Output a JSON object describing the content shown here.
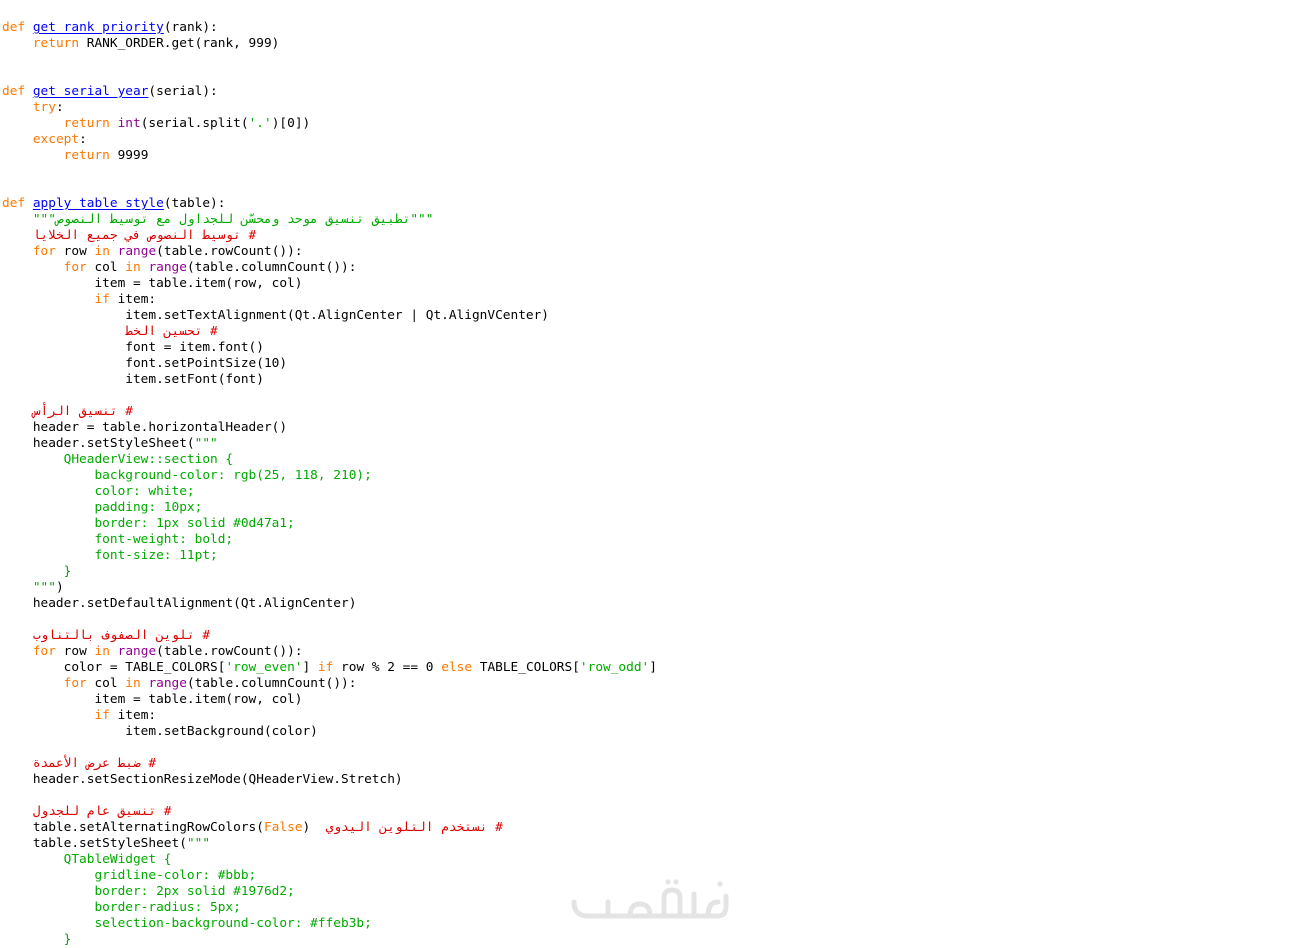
{
  "window": {
    "title": "",
    "background": "#ffffff"
  },
  "syntax_colors": {
    "keyword": "#ff7700",
    "function_name": "#0000ff",
    "builtin": "#900090",
    "string": "#00aa00",
    "comment": "#dd0000",
    "text": "#000000"
  },
  "watermark": {
    "logo": "khamsat-logo",
    "text": "خمسات",
    "color": "#d6d6d6"
  },
  "code": {
    "lines": [
      [
        [
          "kw",
          "def"
        ],
        [
          "t",
          " "
        ],
        [
          "fn",
          "get_rank_priority"
        ],
        [
          "t",
          "(rank):"
        ]
      ],
      [
        [
          "t",
          "    "
        ],
        [
          "kw",
          "return"
        ],
        [
          "t",
          " RANK_ORDER.get(rank, 999)"
        ]
      ],
      [],
      [],
      [
        [
          "kw",
          "def"
        ],
        [
          "t",
          " "
        ],
        [
          "fn",
          "get_serial_year"
        ],
        [
          "t",
          "(serial):"
        ]
      ],
      [
        [
          "t",
          "    "
        ],
        [
          "kw",
          "try"
        ],
        [
          "t",
          ":"
        ]
      ],
      [
        [
          "t",
          "        "
        ],
        [
          "kw",
          "return"
        ],
        [
          "t",
          " "
        ],
        [
          "bi",
          "int"
        ],
        [
          "t",
          "(serial.split("
        ],
        [
          "str",
          "'.'"
        ],
        [
          "t",
          ")[0])"
        ]
      ],
      [
        [
          "t",
          "    "
        ],
        [
          "kw",
          "except"
        ],
        [
          "t",
          ":"
        ]
      ],
      [
        [
          "t",
          "        "
        ],
        [
          "kw",
          "return"
        ],
        [
          "t",
          " 9999"
        ]
      ],
      [],
      [],
      [
        [
          "kw",
          "def"
        ],
        [
          "t",
          " "
        ],
        [
          "fn",
          "apply_table_style"
        ],
        [
          "t",
          "(table):"
        ]
      ],
      [
        [
          "t",
          "    "
        ],
        [
          "str",
          "\"\"\"تطبيق تنسيق موحد ومحسّن للجداول مع توسيط النصوص\"\"\""
        ]
      ],
      [
        [
          "t",
          "    "
        ],
        [
          "cm",
          "# توسيط النصوص في جميع الخلايا"
        ]
      ],
      [
        [
          "t",
          "    "
        ],
        [
          "kw",
          "for"
        ],
        [
          "t",
          " row "
        ],
        [
          "kw",
          "in"
        ],
        [
          "t",
          " "
        ],
        [
          "bi",
          "range"
        ],
        [
          "t",
          "(table.rowCount()):"
        ]
      ],
      [
        [
          "t",
          "        "
        ],
        [
          "kw",
          "for"
        ],
        [
          "t",
          " col "
        ],
        [
          "kw",
          "in"
        ],
        [
          "t",
          " "
        ],
        [
          "bi",
          "range"
        ],
        [
          "t",
          "(table.columnCount()):"
        ]
      ],
      [
        [
          "t",
          "            item = table.item(row, col)"
        ]
      ],
      [
        [
          "t",
          "            "
        ],
        [
          "kw",
          "if"
        ],
        [
          "t",
          " item:"
        ]
      ],
      [
        [
          "t",
          "                item.setTextAlignment(Qt.AlignCenter | Qt.AlignVCenter)"
        ]
      ],
      [
        [
          "t",
          "                "
        ],
        [
          "cm",
          "# تحسين الخط"
        ]
      ],
      [
        [
          "t",
          "                font = item.font()"
        ]
      ],
      [
        [
          "t",
          "                font.setPointSize(10)"
        ]
      ],
      [
        [
          "t",
          "                item.setFont(font)"
        ]
      ],
      [],
      [
        [
          "t",
          "    "
        ],
        [
          "cm",
          "# تنسيق الرأس"
        ]
      ],
      [
        [
          "t",
          "    header = table.horizontalHeader()"
        ]
      ],
      [
        [
          "t",
          "    header.setStyleSheet("
        ],
        [
          "str",
          "\"\"\""
        ]
      ],
      [
        [
          "str",
          "        QHeaderView::section {"
        ]
      ],
      [
        [
          "str",
          "            background-color: rgb(25, 118, 210);"
        ]
      ],
      [
        [
          "str",
          "            color: white;"
        ]
      ],
      [
        [
          "str",
          "            padding: 10px;"
        ]
      ],
      [
        [
          "str",
          "            border: 1px solid #0d47a1;"
        ]
      ],
      [
        [
          "str",
          "            font-weight: bold;"
        ]
      ],
      [
        [
          "str",
          "            font-size: 11pt;"
        ]
      ],
      [
        [
          "str",
          "        }"
        ]
      ],
      [
        [
          "str",
          "    \"\"\""
        ],
        [
          "t",
          ")"
        ]
      ],
      [
        [
          "t",
          "    header.setDefaultAlignment(Qt.AlignCenter)"
        ]
      ],
      [],
      [
        [
          "t",
          "    "
        ],
        [
          "cm",
          "# تلوين الصفوف بالتناوب"
        ]
      ],
      [
        [
          "t",
          "    "
        ],
        [
          "kw",
          "for"
        ],
        [
          "t",
          " row "
        ],
        [
          "kw",
          "in"
        ],
        [
          "t",
          " "
        ],
        [
          "bi",
          "range"
        ],
        [
          "t",
          "(table.rowCount()):"
        ]
      ],
      [
        [
          "t",
          "        color = TABLE_COLORS["
        ],
        [
          "str",
          "'row_even'"
        ],
        [
          "t",
          "] "
        ],
        [
          "kw",
          "if"
        ],
        [
          "t",
          " row % 2 == 0 "
        ],
        [
          "kw",
          "else"
        ],
        [
          "t",
          " TABLE_COLORS["
        ],
        [
          "str",
          "'row_odd'"
        ],
        [
          "t",
          "]"
        ]
      ],
      [
        [
          "t",
          "        "
        ],
        [
          "kw",
          "for"
        ],
        [
          "t",
          " col "
        ],
        [
          "kw",
          "in"
        ],
        [
          "t",
          " "
        ],
        [
          "bi",
          "range"
        ],
        [
          "t",
          "(table.columnCount()):"
        ]
      ],
      [
        [
          "t",
          "            item = table.item(row, col)"
        ]
      ],
      [
        [
          "t",
          "            "
        ],
        [
          "kw",
          "if"
        ],
        [
          "t",
          " item:"
        ]
      ],
      [
        [
          "t",
          "                item.setBackground(color)"
        ]
      ],
      [],
      [
        [
          "t",
          "    "
        ],
        [
          "cm",
          "# ضبط عرض الأعمدة"
        ]
      ],
      [
        [
          "t",
          "    header.setSectionResizeMode(QHeaderView.Stretch)"
        ]
      ],
      [],
      [
        [
          "t",
          "    "
        ],
        [
          "cm",
          "# تنسيق عام للجدول"
        ]
      ],
      [
        [
          "t",
          "    table.setAlternatingRowColors("
        ],
        [
          "kw",
          "False"
        ],
        [
          "t",
          ")  "
        ],
        [
          "cm",
          "# نستخدم التلوين اليدوي"
        ]
      ],
      [
        [
          "t",
          "    table.setStyleSheet("
        ],
        [
          "str",
          "\"\"\""
        ]
      ],
      [
        [
          "str",
          "        QTableWidget {"
        ]
      ],
      [
        [
          "str",
          "            gridline-color: #bbb;"
        ]
      ],
      [
        [
          "str",
          "            border: 2px solid #1976d2;"
        ]
      ],
      [
        [
          "str",
          "            border-radius: 5px;"
        ]
      ],
      [
        [
          "str",
          "            selection-background-color: #ffeb3b;"
        ]
      ],
      [
        [
          "str",
          "        }"
        ]
      ]
    ]
  }
}
